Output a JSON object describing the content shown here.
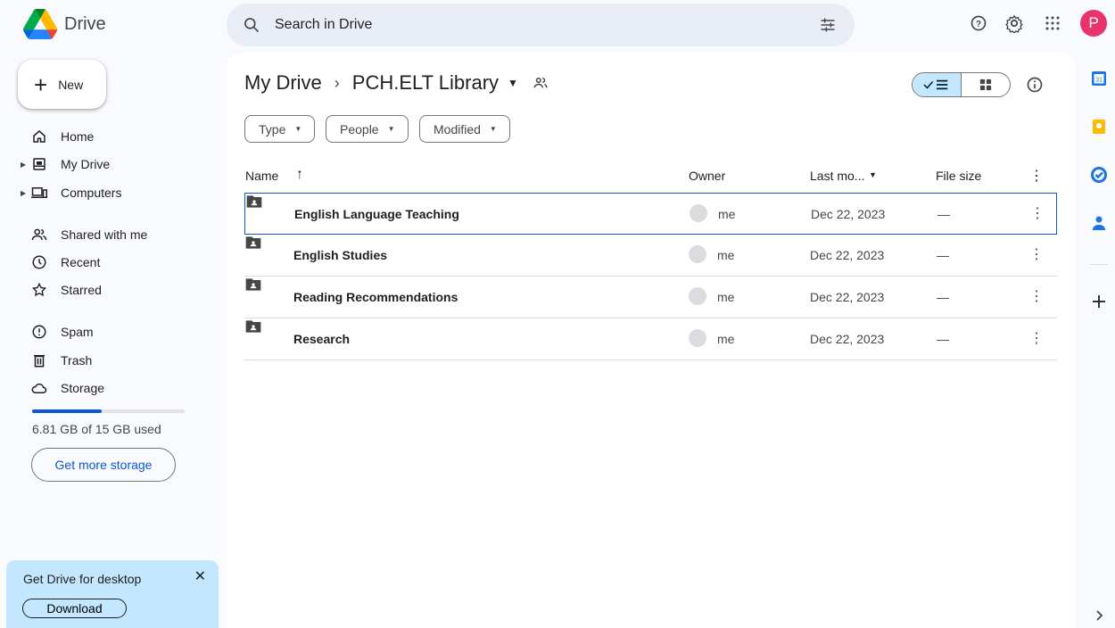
{
  "app": {
    "name": "Drive"
  },
  "search": {
    "placeholder": "Search in Drive"
  },
  "account": {
    "initial": "P",
    "color": "#e8336d"
  },
  "sidebar": {
    "new_label": "New",
    "items": [
      {
        "label": "Home",
        "icon": "home-icon"
      },
      {
        "label": "My Drive",
        "icon": "my-drive-icon"
      },
      {
        "label": "Computers",
        "icon": "computers-icon"
      },
      {
        "label": "Shared with me",
        "icon": "shared-icon"
      },
      {
        "label": "Recent",
        "icon": "clock-icon"
      },
      {
        "label": "Starred",
        "icon": "star-icon"
      },
      {
        "label": "Spam",
        "icon": "spam-icon"
      },
      {
        "label": "Trash",
        "icon": "trash-icon"
      },
      {
        "label": "Storage",
        "icon": "cloud-icon"
      }
    ],
    "storage_used_fraction": 0.454,
    "storage_text": "6.81 GB of 15 GB used",
    "get_storage_label": "Get more storage",
    "promo": {
      "title": "Get Drive for desktop",
      "download_label": "Download"
    }
  },
  "main": {
    "breadcrumb": {
      "root": "My Drive",
      "separator": "›",
      "current": "PCH.ELT Library"
    },
    "filters": [
      "Type",
      "People",
      "Modified"
    ],
    "columns": {
      "name": "Name",
      "owner": "Owner",
      "modified": "Last mo...",
      "size": "File size"
    },
    "rows": [
      {
        "name": "English Language Teaching",
        "owner": "me",
        "modified": "Dec 22, 2023",
        "size": "—"
      },
      {
        "name": "English Studies",
        "owner": "me",
        "modified": "Dec 22, 2023",
        "size": "—"
      },
      {
        "name": "Reading Recommendations",
        "owner": "me",
        "modified": "Dec 22, 2023",
        "size": "—"
      },
      {
        "name": "Research",
        "owner": "me",
        "modified": "Dec 22, 2023",
        "size": "—"
      }
    ]
  },
  "colors": {
    "accent": "#0b57d0",
    "selected_bg": "#c2e7ff",
    "page_bg": "#f8fafd"
  }
}
